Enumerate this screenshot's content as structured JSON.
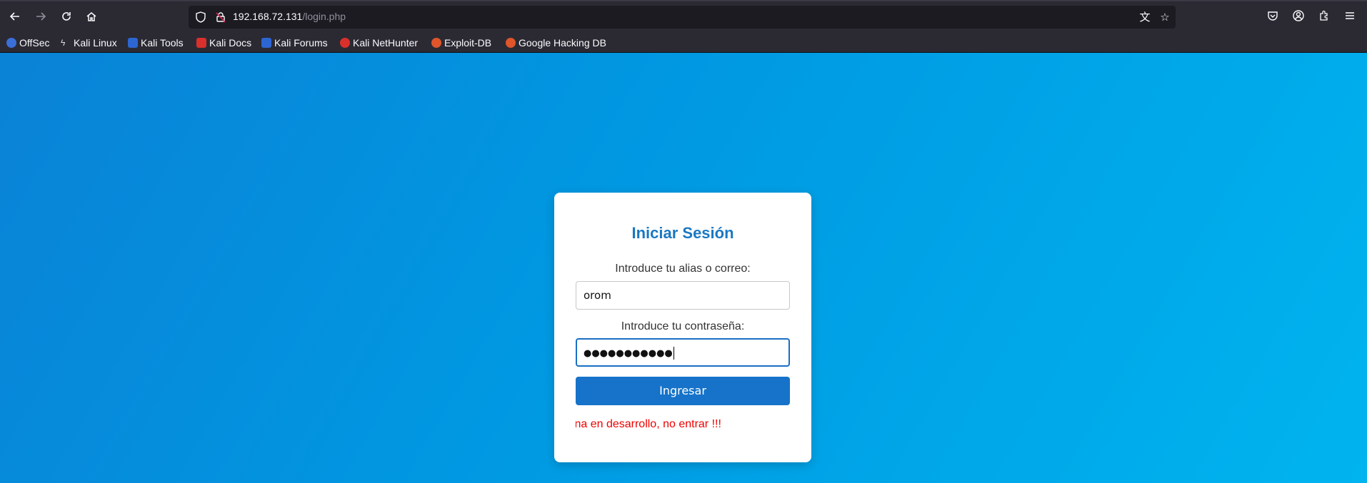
{
  "browser": {
    "url_host": "192.168.72.131",
    "url_path": "/login.php",
    "icons": {
      "back": "arrow-left-icon",
      "forward": "arrow-right-icon",
      "reload": "reload-icon",
      "home": "home-icon",
      "shield": "shield-icon",
      "lock": "insecure-lock-icon",
      "translate": "translate-icon",
      "bookmark": "star-icon",
      "pocket": "pocket-icon",
      "account": "account-icon",
      "extensions": "extensions-icon",
      "menu": "menu-icon"
    }
  },
  "bookmarks": [
    {
      "label": "OffSec",
      "color": "#3b6fd8"
    },
    {
      "label": "Kali Linux",
      "color": "#111111"
    },
    {
      "label": "Kali Tools",
      "color": "#2d66d2"
    },
    {
      "label": "Kali Docs",
      "color": "#d9302c"
    },
    {
      "label": "Kali Forums",
      "color": "#2d66d2"
    },
    {
      "label": "Kali NetHunter",
      "color": "#d9302c"
    },
    {
      "label": "Exploit-DB",
      "color": "#e0552a"
    },
    {
      "label": "Google Hacking DB",
      "color": "#e0552a"
    }
  ],
  "login": {
    "title": "Iniciar Sesión",
    "user_label": "Introduce tu alias o correo:",
    "user_value": "orom",
    "password_label": "Introduce tu contraseña:",
    "password_value": "●●●●●●●●●●●",
    "submit_label": "Ingresar",
    "marquee_text": "gina en desarrollo, no entrar !!!"
  },
  "colors": {
    "page_gradient_start": "#0a82d6",
    "page_gradient_end": "#00b4ef",
    "title": "#1a78c2",
    "button": "#1673c9",
    "warning": "#ee0000"
  }
}
